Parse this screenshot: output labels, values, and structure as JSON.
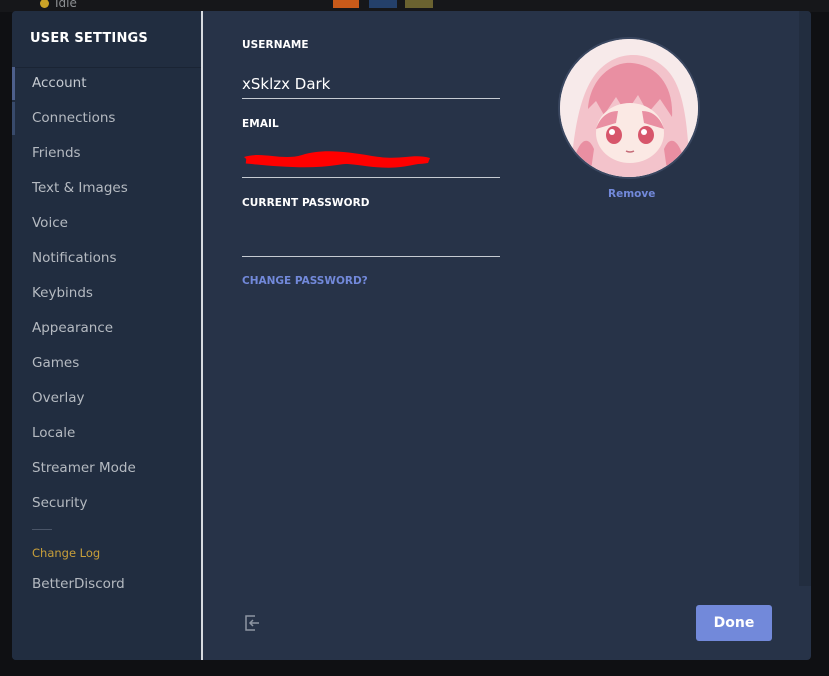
{
  "background": {
    "status_text": "Idle"
  },
  "sidebar": {
    "title": "USER SETTINGS",
    "items": [
      {
        "label": "Account"
      },
      {
        "label": "Connections"
      },
      {
        "label": "Friends"
      },
      {
        "label": "Text & Images"
      },
      {
        "label": "Voice"
      },
      {
        "label": "Notifications"
      },
      {
        "label": "Keybinds"
      },
      {
        "label": "Appearance"
      },
      {
        "label": "Games"
      },
      {
        "label": "Overlay"
      },
      {
        "label": "Locale"
      },
      {
        "label": "Streamer Mode"
      },
      {
        "label": "Security"
      }
    ],
    "changelog": "Change Log",
    "betterdiscord": "BetterDiscord"
  },
  "account": {
    "username_label": "USERNAME",
    "username_value": "xSklzx Dark",
    "email_label": "EMAIL",
    "password_label": "CURRENT PASSWORD",
    "password_value": "",
    "change_password": "CHANGE PASSWORD?",
    "remove_avatar": "Remove"
  },
  "footer": {
    "done_label": "Done"
  },
  "colors": {
    "accent": "#7289da",
    "changelog": "#c89f3a",
    "modal_bg": "#273348",
    "sidebar_bg": "#212d40"
  }
}
